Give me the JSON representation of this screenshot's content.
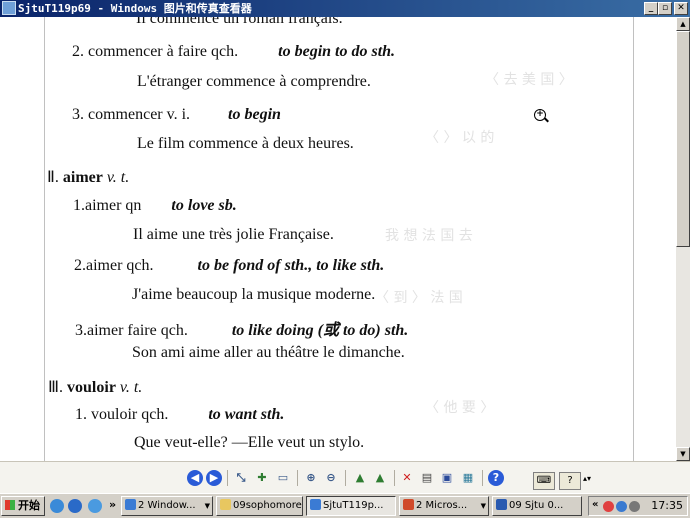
{
  "window": {
    "title": "SjtuT119p69 - Windows 图片和传真查看器",
    "controls": {
      "minimize": "_",
      "maximize": "▫",
      "close": "✕"
    }
  },
  "document": {
    "lines": [
      {
        "fr": "Il commence un roman français."
      },
      {
        "num": "2.",
        "fr": "commencer à faire qch.",
        "en": "to begin to do sth."
      },
      {
        "fr": "L'étranger commence à comprendre."
      },
      {
        "num": "3.",
        "fr": "commencer v. i.",
        "en": "to begin"
      },
      {
        "fr": "Le film commence à deux heures."
      },
      {
        "roman": "Ⅱ.",
        "head": "aimer",
        "pos": "v. t."
      },
      {
        "num": "1.",
        "fr": "aimer qn",
        "en": "to love sb."
      },
      {
        "fr": "Il aime une très jolie Française."
      },
      {
        "num": "2.",
        "fr": "aimer qch.",
        "en": "to be fond of sth., to like sth."
      },
      {
        "fr": "J'aime beaucoup la musique moderne."
      },
      {
        "num": "3.",
        "fr": "aimer faire qch.",
        "en": "to like doing (或 to do) sth."
      },
      {
        "fr": "Son ami aime aller au théâtre le dimanche."
      },
      {
        "roman": "Ⅲ.",
        "head": "vouloir",
        "pos": "v. t."
      },
      {
        "num": "1.",
        "fr": "vouloir qch.",
        "en": "to want sth."
      },
      {
        "fr": "Que veut-elle?  —Elle veut un stylo."
      }
    ]
  },
  "toolbar": {
    "icons": [
      "previous-image-icon",
      "next-image-icon",
      "best-fit-icon",
      "actual-size-icon",
      "slideshow-icon",
      "zoom-in-icon",
      "zoom-out-icon",
      "rotate-clockwise-icon",
      "rotate-counterclockwise-icon",
      "delete-icon",
      "print-icon",
      "save-icon",
      "edit-icon",
      "help-icon"
    ]
  },
  "taskbar": {
    "start_label": "开始",
    "overflow": "»",
    "tasks": [
      {
        "label": "2 Window...",
        "icon_color": "#3b7bd4"
      },
      {
        "label": "09sophomores",
        "icon_color": "#e8c760"
      },
      {
        "label": "SjtuT119p...",
        "icon_color": "#3b7bd4",
        "active": true
      },
      {
        "label": "2 Micros...",
        "icon_color": "#d04a2a"
      },
      {
        "label": "09 Sjtu 0...",
        "icon_color": "#2a5ab0"
      }
    ],
    "tray_overflow": "«",
    "clock": "17:35"
  },
  "colors": {
    "title_gradient_start": "#0a246a",
    "title_gradient_end": "#3a6ea5",
    "chrome": "#d4d0c8",
    "page": "#ffffff"
  }
}
